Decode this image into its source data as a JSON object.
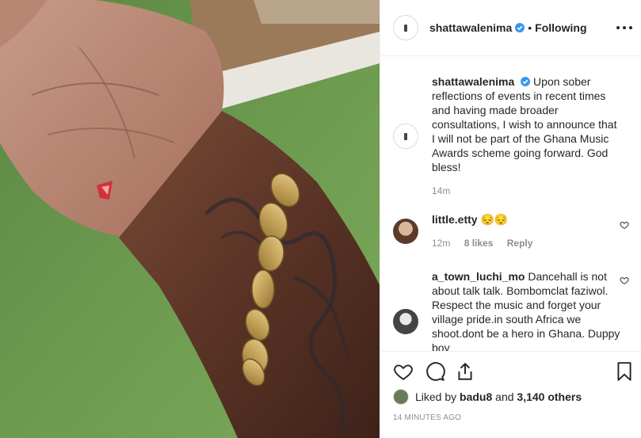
{
  "post": {
    "author": "shattawalenima",
    "following_label": "Following",
    "separator": "•",
    "caption": "Upon sober reflections of events in recent times and having made broader consultations, I wish to announce that I will not be part of the Ghana Music Awards scheme going forward. God bless!",
    "caption_age": "14m"
  },
  "comments": [
    {
      "user": "little.etty",
      "text": "😔😔",
      "age": "12m",
      "likes": "8 likes",
      "reply_label": "Reply"
    },
    {
      "user": "a_town_luchi_mo",
      "text": "Dancehall is not about talk talk. Bombomclat faziwol. Respect the music and forget your village pride.in south Africa we shoot.dont be a hero in Ghana. Duppy boy"
    }
  ],
  "likes": {
    "prefix": "Liked by",
    "user": "badu8",
    "conjunction": "and",
    "others": "3,140 others"
  },
  "timestamp": "14 MINUTES AGO",
  "colors": {
    "verified": "#3897f0",
    "muted": "#8e8e8e",
    "text": "#262626"
  },
  "icons": [
    "verified-badge-icon",
    "more-options-icon",
    "heart-icon",
    "comment-icon",
    "share-icon",
    "bookmark-icon"
  ]
}
